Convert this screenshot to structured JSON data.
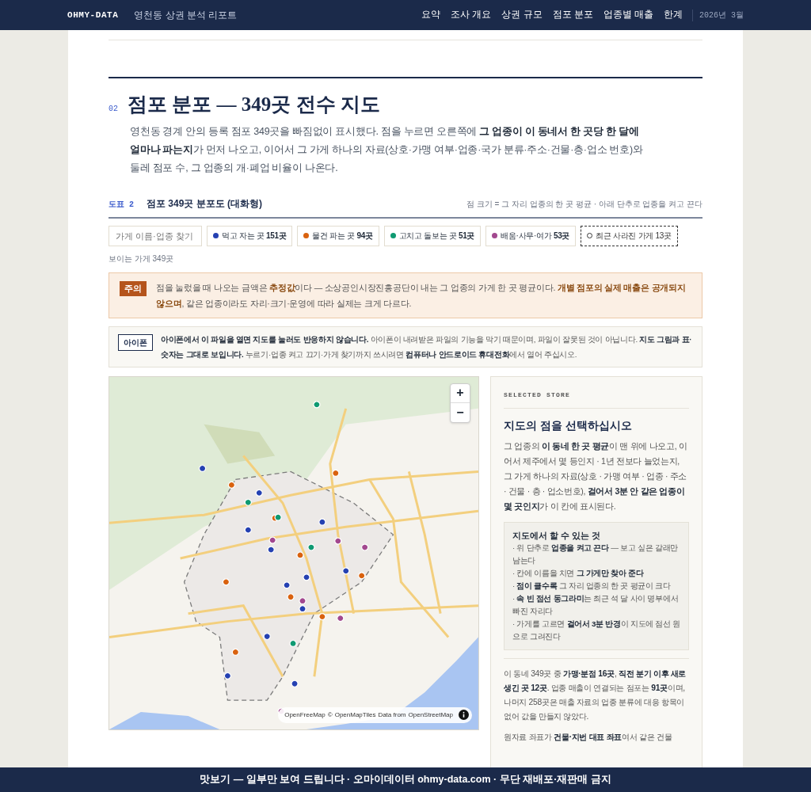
{
  "header": {
    "brand": "OHMY-DATA",
    "report_title": "영천동 상권 분석 리포트",
    "nav": [
      "요약",
      "조사 개요",
      "상권 규모",
      "점포 분포",
      "업종별 매출",
      "한계"
    ],
    "date": "2026년 3월"
  },
  "section": {
    "number": "02",
    "title": "점포 분포 — 349곳 전수 지도",
    "intro": "영천동 경계 안의 등록 점포 349곳을 빠짐없이 표시했다. 점을 누르면 오른쪽에 **그 업종이 이 동네서 한 곳당 한 달에 얼마나 파는지**가 먼저 나오고, 이어서 그 가게 하나의 자료(상호·가맹 여부·업종·국가 분류·주소·건물·층·업소 번호)와 둘레 점포 수, 그 업종의 개·폐업 비율이 나온다."
  },
  "figure": {
    "label": "도표 2",
    "title": "점포 349곳 분포도 (대화형)",
    "note": "점 크기 = 그 자리 업종의 한 곳 평균 · 아래 단추로 업종을 켜고 끈다"
  },
  "search": {
    "placeholder": "가게 이름·업종 찾기"
  },
  "filters": [
    {
      "kind": "category",
      "label": "먹고 자는 곳 **151곳**",
      "color": "#2541b2"
    },
    {
      "kind": "category",
      "label": "물건 파는 곳 **94곳**",
      "color": "#d9620f"
    },
    {
      "kind": "category",
      "label": "고치고 돌보는 곳 **51곳**",
      "color": "#0f9a72"
    },
    {
      "kind": "category",
      "label": "배움·사무·여가 **53곳**",
      "color": "#a2488f"
    },
    {
      "kind": "closed",
      "label": "최근 사라진 가게 13곳"
    }
  ],
  "visible_count": "보이는 가게 349곳",
  "notices": [
    {
      "kind": "caution",
      "badge": "주의",
      "text": "점을 눌렀을 때 나오는 금액은 **추정값**이다 — 소상공인시장진흥공단이 내는 그 업종의 가게 한 곳 평균이다. **개별 점포의 실제 매출은 공개되지 않으며**, 같은 업종이라도 자리·크기·운영에 따라 실제는 크게 다르다."
    },
    {
      "kind": "info",
      "badge": "아이폰",
      "text": "**아이폰에서 이 파일을 열면 지도를 눌러도 반응하지 않습니다.** 아이폰이 내려받은 파일의 기능을 막기 때문이며, 파일이 잘못된 것이 아닙니다. **지도 그림과 표·숫자는 그대로 보입니다.** 누르기·업종 켜고 끄기·가게 찾기까지 쓰시려면 **컴퓨터나 안드로이드 휴대전화**에서 열어 주십시오."
    }
  ],
  "map": {
    "zoom_in": "+",
    "zoom_out": "−",
    "attribution": [
      "OpenFreeMap",
      "©",
      "OpenMapTiles",
      "Data from",
      "OpenStreetMap"
    ]
  },
  "panel": {
    "eyebrow": "SELECTED STORE",
    "heading": "지도의 점을 선택하십시오",
    "body": "그 업종의 **이 동네 한 곳 평균**이 맨 위에 나오고, 이어서 제주에서 몇 등인지 · 1년 전보다 늘었는지, 그 가게 하나의 자료(상호 · 가맹 여부 · 업종 · 주소 · 건물 · 층 · 업소번호), **걸어서 3분 안 같은 업종이 몇 곳인지**가 이 칸에 표시된다.",
    "howto": {
      "title": "지도에서 할 수 있는 것",
      "items": [
        "· 위 단추로 **업종을 켜고 끈다** — 보고 싶은 갈래만 남는다",
        "· 칸에 이름을 치면 **그 가게만 찾아 준다**",
        "· **점이 클수록** 그 자리 업종의 한 곳 평균이 크다",
        "· **속 빈 점선 동그라미**는 최근 석 달 사이 명부에서 빠진 자리다",
        "· 가게를 고르면 **걸어서 3분 반경**이 지도에 점선 원으로 그려진다"
      ]
    },
    "stats": "이 동네 349곳 중 **가맹·분점 16곳**, **직전 분기 이후 새로 생긴 곳 12곳**. 업종 매출이 연결되는 점포는 **91곳**이며, 나머지 258곳은 매출 자료의 업종 분류에 대응 항목이 없어 값을 만들지 않았다.",
    "note": "원자료 좌표가 **건물·지번 대표 좌표**여서 같은 건물"
  },
  "banner": "맛보기 — 일부만 보여 드립니다 · 오마이데이터 ohmy-data.com · 무단 재배포·재판매 금지"
}
